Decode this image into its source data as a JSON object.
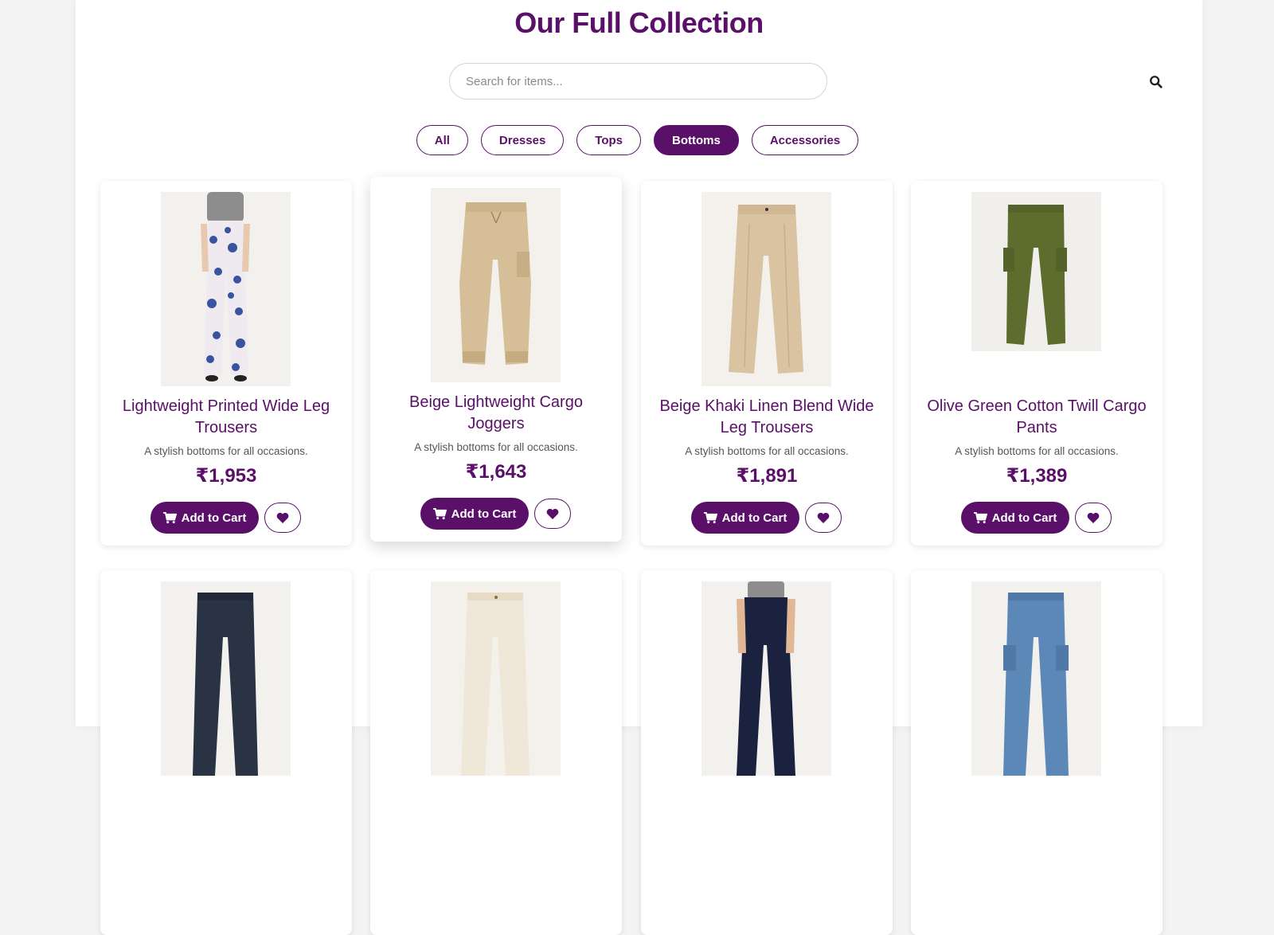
{
  "page": {
    "title": "Our Full Collection"
  },
  "search": {
    "placeholder": "Search for items...",
    "value": "",
    "icon": "search-icon"
  },
  "filters": [
    {
      "label": "All",
      "active": false
    },
    {
      "label": "Dresses",
      "active": false
    },
    {
      "label": "Tops",
      "active": false
    },
    {
      "label": "Bottoms",
      "active": true
    },
    {
      "label": "Accessories",
      "active": false
    }
  ],
  "products": [
    {
      "name": "Lightweight Printed Wide Leg Trousers",
      "desc": "A stylish bottoms for all occasions.",
      "price": "₹1,953",
      "image": "floral-trousers",
      "cart_label": "Add to Cart"
    },
    {
      "name": "Beige Lightweight Cargo Joggers",
      "desc": "A stylish bottoms for all occasions.",
      "price": "₹1,643",
      "image": "beige-joggers",
      "cart_label": "Add to Cart"
    },
    {
      "name": "Beige Khaki Linen Blend Wide Leg Trousers",
      "desc": "A stylish bottoms for all occasions.",
      "price": "₹1,891",
      "image": "khaki-trousers",
      "cart_label": "Add to Cart"
    },
    {
      "name": "Olive Green Cotton Twill Cargo Pants",
      "desc": "A stylish bottoms for all occasions.",
      "price": "₹1,389",
      "image": "olive-cargo",
      "cart_label": "Add to Cart"
    },
    {
      "name": "",
      "desc": "",
      "price": "",
      "image": "dark-denim-jeans",
      "cart_label": ""
    },
    {
      "name": "",
      "desc": "",
      "price": "",
      "image": "cream-jeans",
      "cart_label": ""
    },
    {
      "name": "",
      "desc": "",
      "price": "",
      "image": "navy-trousers",
      "cart_label": ""
    },
    {
      "name": "",
      "desc": "",
      "price": "",
      "image": "blue-cargo-jeans",
      "cart_label": ""
    }
  ],
  "colors": {
    "accent": "#5a0f68",
    "background": "#ffffff"
  }
}
